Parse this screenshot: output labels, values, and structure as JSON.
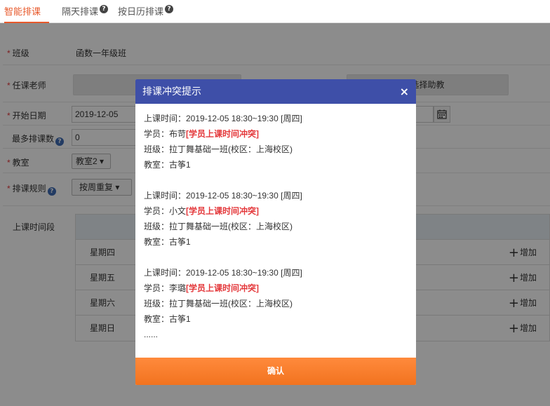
{
  "tabs": [
    {
      "label": "智能排课",
      "help": false
    },
    {
      "label": "隔天排课",
      "help": true
    },
    {
      "label": "按日历排课",
      "help": true
    }
  ],
  "help_glyph": "?",
  "form": {
    "class_label": "班级",
    "class_value": "函数一年级班",
    "teacher_label": "任课老师",
    "assistant_button": "选择助教",
    "start_date_label": "开始日期",
    "start_date_value": "2019-12-05",
    "max_courses_label": "最多排课数",
    "max_courses_value": "0",
    "classroom_label": "教室",
    "classroom_value": "教室2 ▾",
    "rule_label": "排课规则",
    "rule_value": "按周重复 ▾",
    "time_slot_label": "上课时间段",
    "required_mark": "*"
  },
  "schedule": {
    "add_label": "增加",
    "plus_glyph": "+",
    "days": [
      "星期四",
      "星期五",
      "星期六",
      "星期日"
    ]
  },
  "modal": {
    "title": "排课冲突提示",
    "close_glyph": "×",
    "conflicts": [
      {
        "time": "上课时间：2019-12-05 18:30~19:30 [周四]",
        "student_prefix": "学员：布苛",
        "student_flag": "[学员上课时间冲突]",
        "class": "班级：拉丁舞基础一班(校区：上海校区)",
        "room": "教室：古筝1"
      },
      {
        "time": "上课时间：2019-12-05 18:30~19:30 [周四]",
        "student_prefix": "学员：小文",
        "student_flag": "[学员上课时间冲突]",
        "class": "班级：拉丁舞基础一班(校区：上海校区)",
        "room": "教室：古筝1"
      },
      {
        "time": "上课时间：2019-12-05 18:30~19:30 [周四]",
        "student_prefix": "学员：李璐",
        "student_flag": "[学员上课时间冲突]",
        "class": "班级：拉丁舞基础一班(校区：上海校区)",
        "room": "教室：古筝1"
      }
    ],
    "more": "......",
    "confirm": "确认"
  }
}
